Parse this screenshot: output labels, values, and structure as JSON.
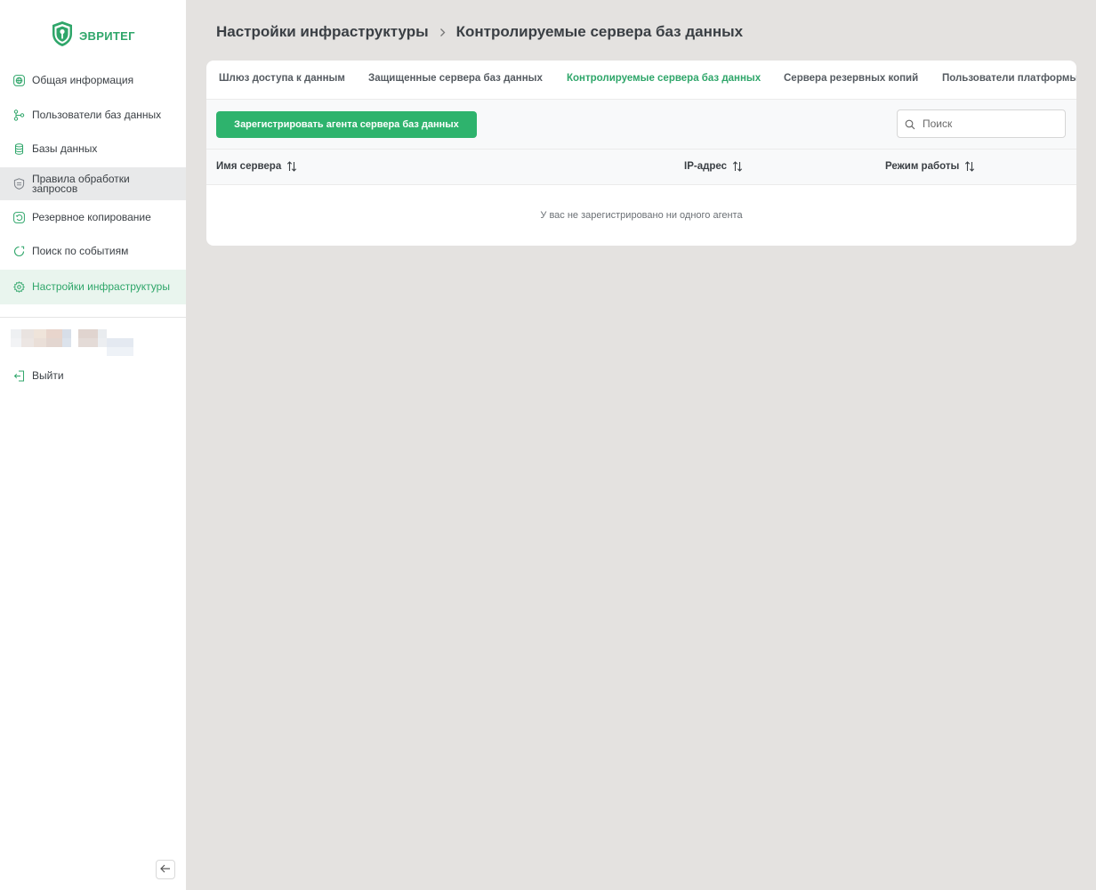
{
  "brand": {
    "name": "ЭВРИТЕГ",
    "color": "#2fa66a"
  },
  "sidebar": {
    "items": [
      {
        "label": "Общая информация",
        "icon": "globe-icon"
      },
      {
        "label": "Пользователи баз данных",
        "icon": "users-network-icon"
      },
      {
        "label": "Базы данных",
        "icon": "database-icon"
      },
      {
        "label": "Правила обработки запросов",
        "icon": "shield-icon"
      },
      {
        "label": "Резервное копирование",
        "icon": "backup-icon"
      },
      {
        "label": "Поиск по событиям",
        "icon": "history-search-icon"
      },
      {
        "label": "Настройки инфраструктуры",
        "icon": "gear-icon"
      }
    ],
    "active_item": "Настройки инфраструктуры",
    "logout_label": "Выйти"
  },
  "breadcrumb": {
    "parent": "Настройки инфраструктуры",
    "current": "Контролируемые сервера баз данных"
  },
  "tabs": [
    {
      "label": "Шлюз доступа к данным"
    },
    {
      "label": "Защищенные сервера баз данных"
    },
    {
      "label": "Контролируемые сервера баз данных",
      "active": true
    },
    {
      "label": "Сервера резервных копий"
    },
    {
      "label": "Пользователи платформы"
    }
  ],
  "toolbar": {
    "register_button": "Зарегистрировать агента сервера баз данных",
    "search_placeholder": "Поиск"
  },
  "table": {
    "columns": [
      "Имя сервера",
      "IP-адрес",
      "Режим работы"
    ],
    "empty_message": "У вас не зарегистрировано ни одного агента"
  },
  "colors": {
    "accent": "#2eb36d",
    "background": "#e4e2e0",
    "active_nav_bg": "#e9f5ee"
  }
}
